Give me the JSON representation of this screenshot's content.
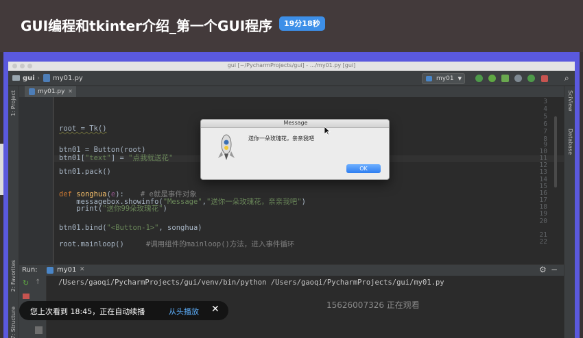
{
  "course": {
    "title": "GUI编程和tkinter介绍_第一个GUI程序",
    "duration_badge": "19分18秒"
  },
  "window": {
    "title": "gui [~/PycharmProjects/gui] - .../my01.py [gui]"
  },
  "navbar": {
    "project": "gui",
    "file": "my01.py",
    "run_config": "my01"
  },
  "tab": {
    "label": "my01.py"
  },
  "side_labels": {
    "project": "1: Project",
    "favorites": "2: Favorites",
    "structure": "7: Structure",
    "sciview": "SciView",
    "database": "Database"
  },
  "editor": {
    "line_numbers": [
      "3",
      "4",
      "5",
      "6",
      "7",
      "8",
      "9",
      "10",
      "11",
      "12",
      "13",
      "14",
      "15",
      "16",
      "17",
      "18",
      "19",
      "20",
      "21",
      "22"
    ],
    "code": {
      "l6": "root = Tk()",
      "l9": "btn01 = Button(root)",
      "l10_a": "btn01[",
      "l10_b": "\"text\"",
      "l10_c": "] = ",
      "l10_d": "\"点我就送花\"",
      "l12": "btn01.pack()",
      "l15_kw": "def ",
      "l15_fn": "songhua",
      "l15_a": "(",
      "l15_param": "e",
      "l15_b": "):",
      "l15_comment": "# e就是事件对象",
      "l16_a": "    messagebox.showinfo(",
      "l16_b": "\"Message\"",
      "l16_c": ",",
      "l16_d": "\"送你一朵玫瑰花，亲亲我吧\"",
      "l16_e": ")",
      "l17_a": "    print(",
      "l17_b": "\"送你99朵玫瑰花\"",
      "l17_c": ")",
      "l20_a": "btn01.bind(",
      "l20_b": "\"<Button-1>\"",
      "l20_c": ", songhua)",
      "l22_a": "root.mainloop()",
      "l22_comment": "#调用组件的mainloop()方法，进入事件循环"
    }
  },
  "run_panel": {
    "label": "Run:",
    "config": "my01",
    "command": "/Users/gaoqi/PycharmProjects/gui/venv/bin/python /Users/gaoqi/PycharmProjects/gui/my01.py"
  },
  "dialog": {
    "title": "Message",
    "message": "送你一朵玫瑰花，亲亲我吧",
    "ok_label": "OK"
  },
  "watermark": "15626007326 正在观看",
  "toast": {
    "text": "您上次看到 18:45，正在自动续播",
    "action": "从头播放",
    "close": "✕"
  },
  "colors": {
    "frame_accent": "#5a59de",
    "badge": "#3d8fe8",
    "toast_link": "#5aaaf5",
    "keyword": "#cc7832",
    "string": "#6a8759"
  }
}
